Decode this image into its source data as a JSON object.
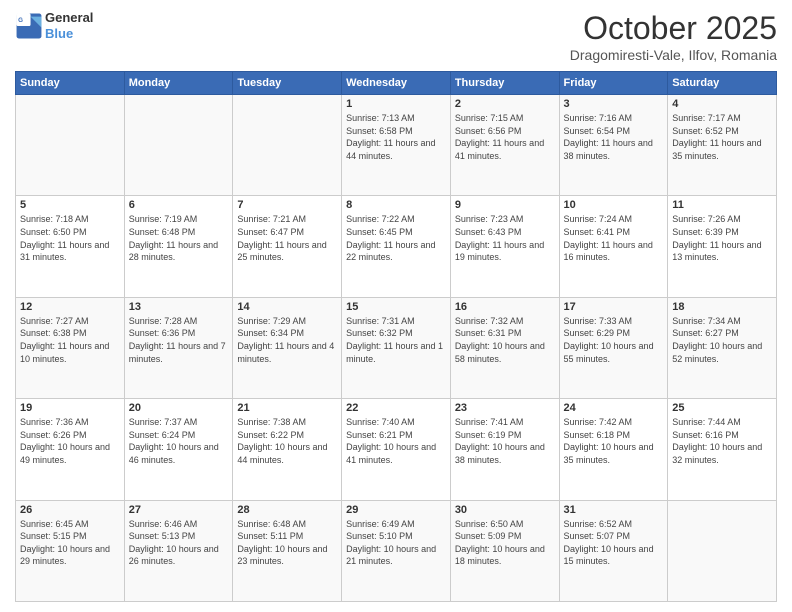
{
  "header": {
    "logo_line1": "General",
    "logo_line2": "Blue",
    "month": "October 2025",
    "location": "Dragomiresti-Vale, Ilfov, Romania"
  },
  "days_of_week": [
    "Sunday",
    "Monday",
    "Tuesday",
    "Wednesday",
    "Thursday",
    "Friday",
    "Saturday"
  ],
  "weeks": [
    [
      {
        "day": "",
        "info": ""
      },
      {
        "day": "",
        "info": ""
      },
      {
        "day": "",
        "info": ""
      },
      {
        "day": "1",
        "info": "Sunrise: 7:13 AM\nSunset: 6:58 PM\nDaylight: 11 hours and 44 minutes."
      },
      {
        "day": "2",
        "info": "Sunrise: 7:15 AM\nSunset: 6:56 PM\nDaylight: 11 hours and 41 minutes."
      },
      {
        "day": "3",
        "info": "Sunrise: 7:16 AM\nSunset: 6:54 PM\nDaylight: 11 hours and 38 minutes."
      },
      {
        "day": "4",
        "info": "Sunrise: 7:17 AM\nSunset: 6:52 PM\nDaylight: 11 hours and 35 minutes."
      }
    ],
    [
      {
        "day": "5",
        "info": "Sunrise: 7:18 AM\nSunset: 6:50 PM\nDaylight: 11 hours and 31 minutes."
      },
      {
        "day": "6",
        "info": "Sunrise: 7:19 AM\nSunset: 6:48 PM\nDaylight: 11 hours and 28 minutes."
      },
      {
        "day": "7",
        "info": "Sunrise: 7:21 AM\nSunset: 6:47 PM\nDaylight: 11 hours and 25 minutes."
      },
      {
        "day": "8",
        "info": "Sunrise: 7:22 AM\nSunset: 6:45 PM\nDaylight: 11 hours and 22 minutes."
      },
      {
        "day": "9",
        "info": "Sunrise: 7:23 AM\nSunset: 6:43 PM\nDaylight: 11 hours and 19 minutes."
      },
      {
        "day": "10",
        "info": "Sunrise: 7:24 AM\nSunset: 6:41 PM\nDaylight: 11 hours and 16 minutes."
      },
      {
        "day": "11",
        "info": "Sunrise: 7:26 AM\nSunset: 6:39 PM\nDaylight: 11 hours and 13 minutes."
      }
    ],
    [
      {
        "day": "12",
        "info": "Sunrise: 7:27 AM\nSunset: 6:38 PM\nDaylight: 11 hours and 10 minutes."
      },
      {
        "day": "13",
        "info": "Sunrise: 7:28 AM\nSunset: 6:36 PM\nDaylight: 11 hours and 7 minutes."
      },
      {
        "day": "14",
        "info": "Sunrise: 7:29 AM\nSunset: 6:34 PM\nDaylight: 11 hours and 4 minutes."
      },
      {
        "day": "15",
        "info": "Sunrise: 7:31 AM\nSunset: 6:32 PM\nDaylight: 11 hours and 1 minute."
      },
      {
        "day": "16",
        "info": "Sunrise: 7:32 AM\nSunset: 6:31 PM\nDaylight: 10 hours and 58 minutes."
      },
      {
        "day": "17",
        "info": "Sunrise: 7:33 AM\nSunset: 6:29 PM\nDaylight: 10 hours and 55 minutes."
      },
      {
        "day": "18",
        "info": "Sunrise: 7:34 AM\nSunset: 6:27 PM\nDaylight: 10 hours and 52 minutes."
      }
    ],
    [
      {
        "day": "19",
        "info": "Sunrise: 7:36 AM\nSunset: 6:26 PM\nDaylight: 10 hours and 49 minutes."
      },
      {
        "day": "20",
        "info": "Sunrise: 7:37 AM\nSunset: 6:24 PM\nDaylight: 10 hours and 46 minutes."
      },
      {
        "day": "21",
        "info": "Sunrise: 7:38 AM\nSunset: 6:22 PM\nDaylight: 10 hours and 44 minutes."
      },
      {
        "day": "22",
        "info": "Sunrise: 7:40 AM\nSunset: 6:21 PM\nDaylight: 10 hours and 41 minutes."
      },
      {
        "day": "23",
        "info": "Sunrise: 7:41 AM\nSunset: 6:19 PM\nDaylight: 10 hours and 38 minutes."
      },
      {
        "day": "24",
        "info": "Sunrise: 7:42 AM\nSunset: 6:18 PM\nDaylight: 10 hours and 35 minutes."
      },
      {
        "day": "25",
        "info": "Sunrise: 7:44 AM\nSunset: 6:16 PM\nDaylight: 10 hours and 32 minutes."
      }
    ],
    [
      {
        "day": "26",
        "info": "Sunrise: 6:45 AM\nSunset: 5:15 PM\nDaylight: 10 hours and 29 minutes."
      },
      {
        "day": "27",
        "info": "Sunrise: 6:46 AM\nSunset: 5:13 PM\nDaylight: 10 hours and 26 minutes."
      },
      {
        "day": "28",
        "info": "Sunrise: 6:48 AM\nSunset: 5:11 PM\nDaylight: 10 hours and 23 minutes."
      },
      {
        "day": "29",
        "info": "Sunrise: 6:49 AM\nSunset: 5:10 PM\nDaylight: 10 hours and 21 minutes."
      },
      {
        "day": "30",
        "info": "Sunrise: 6:50 AM\nSunset: 5:09 PM\nDaylight: 10 hours and 18 minutes."
      },
      {
        "day": "31",
        "info": "Sunrise: 6:52 AM\nSunset: 5:07 PM\nDaylight: 10 hours and 15 minutes."
      },
      {
        "day": "",
        "info": ""
      }
    ]
  ]
}
